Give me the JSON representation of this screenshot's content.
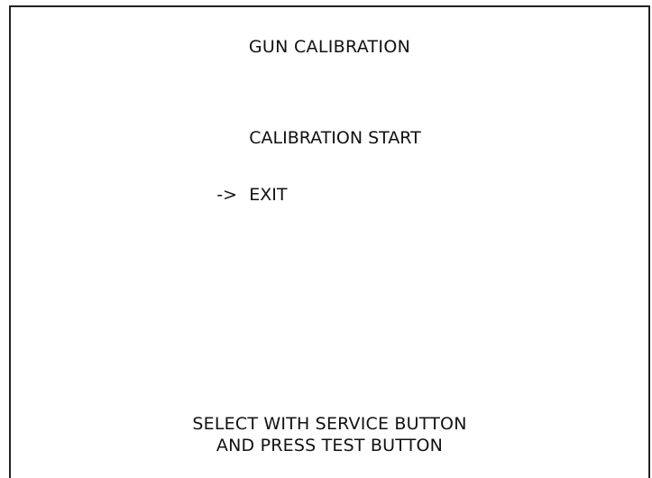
{
  "screen": {
    "title": "GUN CALIBRATION",
    "menu": {
      "cursor": "->",
      "items": [
        {
          "label": "CALIBRATION START",
          "selected": false
        },
        {
          "label": "EXIT",
          "selected": true
        }
      ]
    },
    "footer": {
      "line1": "SELECT WITH SERVICE BUTTON",
      "line2": "AND PRESS TEST BUTTON"
    }
  }
}
